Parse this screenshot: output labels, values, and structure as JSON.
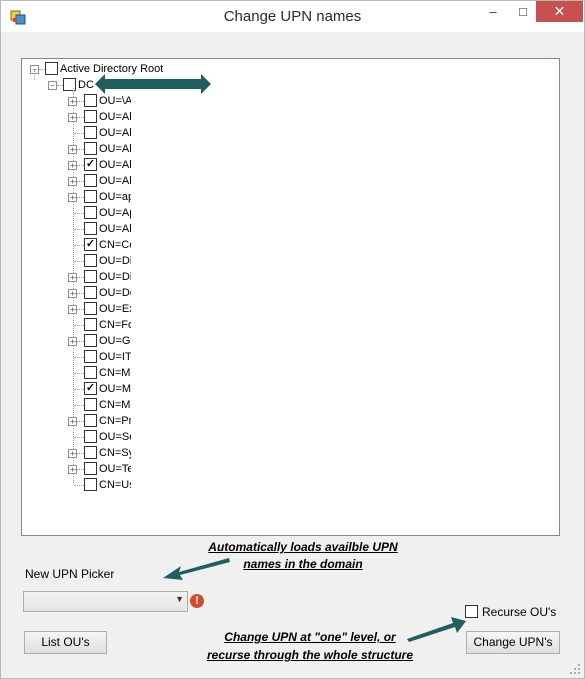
{
  "window": {
    "title": "Change UPN names",
    "minimize_glyph": "–",
    "maximize_glyph": "□",
    "close_glyph": "✕"
  },
  "tree": {
    "root": {
      "label": "Active Directory Root",
      "checked": false
    },
    "domain": {
      "label": "DC",
      "checked": false
    },
    "nodes": [
      {
        "label": "OU=\\A",
        "checked": false,
        "expander": true
      },
      {
        "label": "OU=Al",
        "checked": false,
        "expander": true
      },
      {
        "label": "OU=Al",
        "checked": false,
        "expander": false
      },
      {
        "label": "OU=Al",
        "checked": false,
        "expander": true
      },
      {
        "label": "OU=Al",
        "checked": true,
        "expander": true
      },
      {
        "label": "OU=Al",
        "checked": false,
        "expander": true
      },
      {
        "label": "OU=ap",
        "checked": false,
        "expander": true
      },
      {
        "label": "OU=Ap",
        "checked": false,
        "expander": false
      },
      {
        "label": "OU=Al",
        "checked": false,
        "expander": false
      },
      {
        "label": "CN=Co",
        "checked": true,
        "expander": false
      },
      {
        "label": "OU=Di",
        "checked": false,
        "expander": false
      },
      {
        "label": "OU=Di",
        "checked": false,
        "expander": true
      },
      {
        "label": "OU=Do",
        "checked": false,
        "expander": true
      },
      {
        "label": "OU=Ex",
        "checked": false,
        "expander": true
      },
      {
        "label": "CN=Fo",
        "checked": false,
        "expander": false
      },
      {
        "label": "OU=Gl",
        "checked": false,
        "expander": true
      },
      {
        "label": "OU=IT",
        "checked": false,
        "expander": false
      },
      {
        "label": "CN=Ma",
        "checked": false,
        "expander": false
      },
      {
        "label": "OU=M",
        "checked": true,
        "expander": false
      },
      {
        "label": "CN=Mi",
        "checked": false,
        "expander": false
      },
      {
        "label": "CN=Pr",
        "checked": false,
        "expander": true
      },
      {
        "label": "OU=Se",
        "checked": false,
        "expander": false
      },
      {
        "label": "CN=Sy",
        "checked": false,
        "expander": true
      },
      {
        "label": "OU=Te",
        "checked": false,
        "expander": true
      },
      {
        "label": "CN=Us",
        "checked": false,
        "expander": false
      }
    ]
  },
  "annotations": {
    "auto_load_line1": "Automatically loads availble UPN",
    "auto_load_line2": "names in the domain",
    "change_level_line1": "Change UPN at \"one\" level, or",
    "change_level_line2": "recurse through the whole structure"
  },
  "form": {
    "new_upn_label": "New UPN Picker",
    "combo_value": "",
    "recurse_label": "Recurse OU's",
    "recurse_checked": false,
    "list_button": "List OU's",
    "change_button": "Change UPN's",
    "error_glyph": "!"
  },
  "colors": {
    "annotation_arrow": "#1f5f5f",
    "close_button": "#c75050",
    "error_icon": "#d64a2b"
  }
}
